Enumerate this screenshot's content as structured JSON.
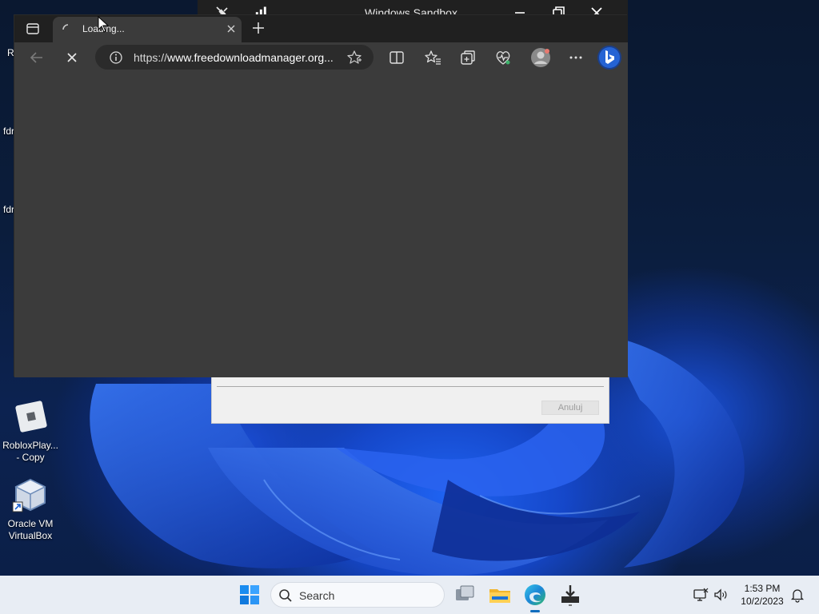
{
  "sandbox_window": {
    "title": "Windows Sandbox"
  },
  "browser": {
    "tab": {
      "title": "Loading..."
    },
    "address_bar": {
      "scheme": "https://",
      "host_text": "www.freedownloadmanager.org..."
    },
    "toolbar_icons": [
      "back-icon",
      "stop-loading-icon",
      "site-info-icon",
      "add-favorite-star-icon",
      "split-screen-icon",
      "favorites-icon",
      "collections-icon",
      "browser-essentials-icon",
      "profile-icon",
      "more-options-icon",
      "bing-copilot-icon"
    ]
  },
  "dialog": {
    "cancel_label": "Anuluj"
  },
  "desktop": {
    "edge_labels": [
      "Re",
      "fdr",
      "fdr"
    ],
    "icons": [
      {
        "label": "RobloxPlay... - Copy",
        "icon": "roblox-icon"
      },
      {
        "label": "Oracle VM VirtualBox",
        "icon": "virtualbox-icon"
      }
    ]
  },
  "taskbar": {
    "search_placeholder": "Search",
    "apps": [
      "start-icon",
      "task-view-icon",
      "file-explorer-icon",
      "edge-icon",
      "download-manager-icon"
    ],
    "clock": {
      "time": "1:53 PM",
      "date": "10/2/2023"
    }
  },
  "colors": {
    "browser_bg": "#3b3b3b",
    "titlebar_bg": "#202020",
    "taskbar_bg": "#e8edf4",
    "accent": "#0f6cbd"
  }
}
